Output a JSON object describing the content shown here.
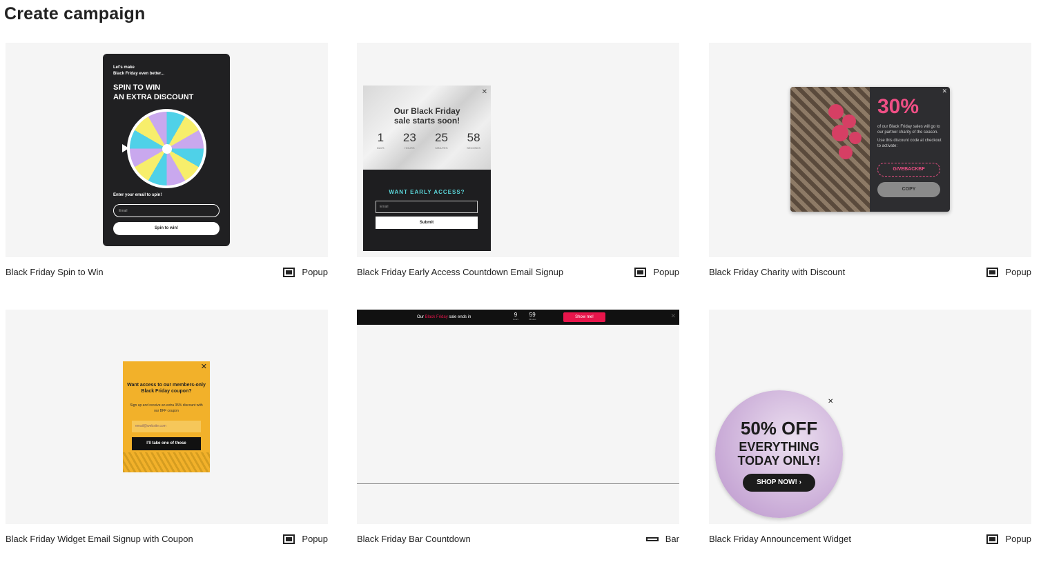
{
  "page": {
    "title": "Create campaign"
  },
  "cards": [
    {
      "name": "Black Friday Spin to Win",
      "type": "Popup",
      "preview": {
        "pre_line1": "Let's make",
        "pre_line2": "Black Friday even better...",
        "headline_line1": "SPIN TO WIN",
        "headline_line2": "AN EXTRA DISCOUNT",
        "email_label": "Enter your email to spin!",
        "email_placeholder": "Email",
        "button": "Spin to win!"
      }
    },
    {
      "name": "Black Friday Early Access Countdown Email Signup",
      "type": "Popup",
      "preview": {
        "headline_line1": "Our Black Friday",
        "headline_line2": "sale starts soon!",
        "countdown": [
          {
            "value": "1",
            "unit": "DAYS"
          },
          {
            "value": "23",
            "unit": "HOURS"
          },
          {
            "value": "25",
            "unit": "MINUTES"
          },
          {
            "value": "58",
            "unit": "SECONDS"
          }
        ],
        "subhead": "WANT EARLY ACCESS?",
        "email_placeholder": "Email",
        "button": "Submit"
      }
    },
    {
      "name": "Black Friday Charity with Discount",
      "type": "Popup",
      "preview": {
        "percent": "30%",
        "text1": "of our Black Friday sales will go to our partner charity of the season.",
        "text2": "Use this discount code at checkout to activate:",
        "code": "GIVEBACKBF",
        "button": "COPY"
      }
    },
    {
      "name": "Black Friday Widget Email Signup with Coupon",
      "type": "Popup",
      "preview": {
        "headline": "Want access to our members-only Black Friday coupon?",
        "sub": "Sign up and receive an extra 35% discount with our BFF coupon",
        "email_placeholder": "email@website.com",
        "button": "I'll take one of those"
      }
    },
    {
      "name": "Black Friday Bar Countdown",
      "type": "Bar",
      "preview": {
        "text_pre": "Our",
        "text_highlight": "Black Friday",
        "text_post": "sale ends in",
        "hours": "9",
        "hours_unit": "Hours",
        "minutes": "59",
        "minutes_unit": "Minutes",
        "button": "Show me!"
      }
    },
    {
      "name": "Black Friday Announcement Widget",
      "type": "Popup",
      "preview": {
        "line1": "50% OFF",
        "line2": "EVERYTHING",
        "line3": "TODAY ONLY!",
        "button": "SHOP NOW! ›"
      }
    }
  ],
  "icons": {
    "close": "close-icon",
    "popup": "popup-type-icon",
    "bar": "bar-type-icon"
  },
  "colors": {
    "accent_pink": "#e8154b",
    "teal": "#5bd6d9",
    "yellow": "#f2b12a"
  }
}
